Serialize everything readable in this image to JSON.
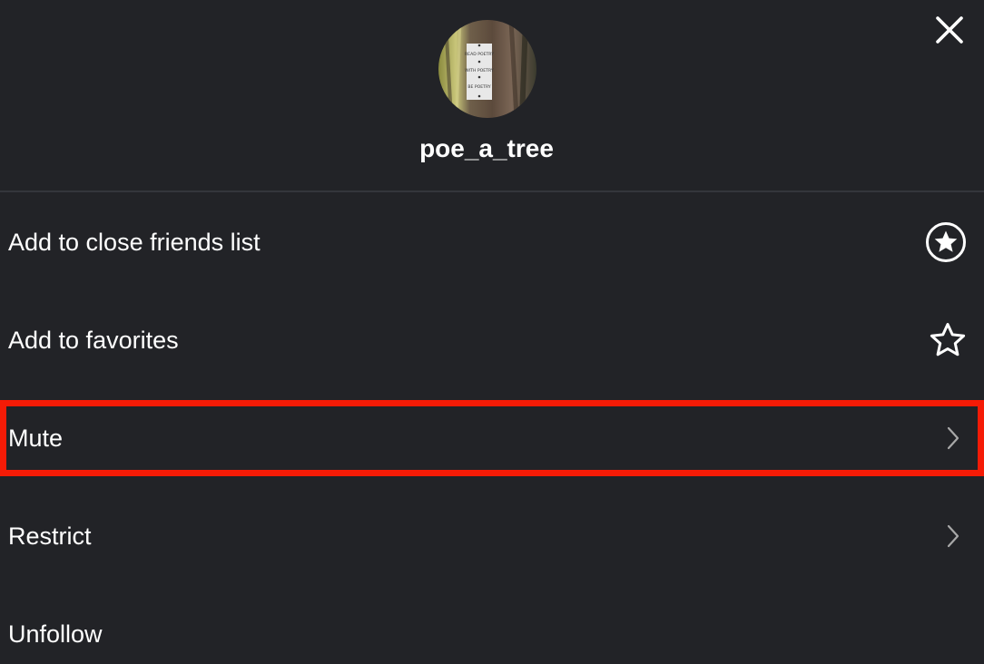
{
  "profile": {
    "username": "poe_a_tree",
    "avatar_sign_text": [
      "READ POETRY",
      "WITH POETRY",
      "BE POETRY"
    ]
  },
  "menu": {
    "items": [
      {
        "label": "Add to close friends list",
        "icon": "circled-star-icon"
      },
      {
        "label": "Add to favorites",
        "icon": "star-outline-icon"
      },
      {
        "label": "Mute",
        "icon": "chevron-right-icon"
      },
      {
        "label": "Restrict",
        "icon": "chevron-right-icon"
      },
      {
        "label": "Unfollow",
        "icon": ""
      }
    ]
  },
  "colors": {
    "background": "#222327",
    "divider": "#34363b",
    "text": "#ffffff",
    "chevron": "#a8a8a8",
    "highlight": "#f51b06"
  },
  "icons": {
    "close": "close-icon"
  }
}
